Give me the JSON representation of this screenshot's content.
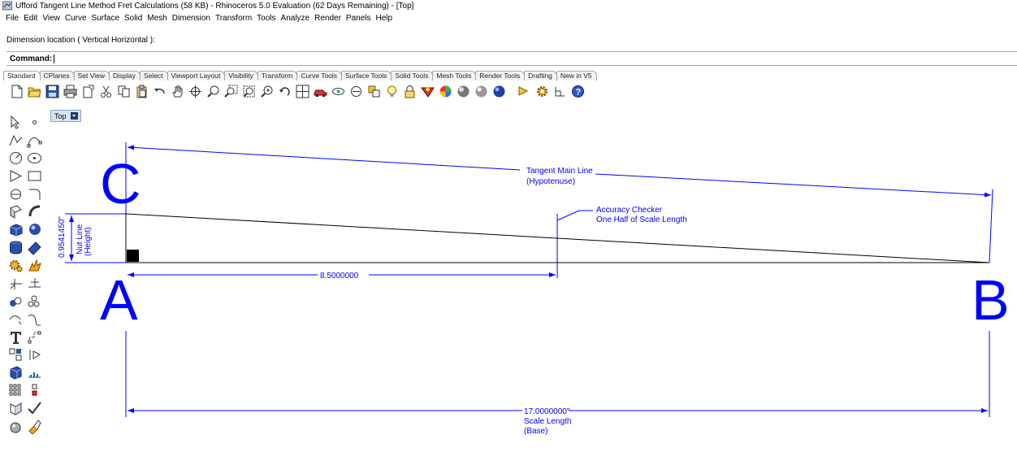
{
  "window": {
    "title": "Ufford Tangent Line Method Fret Calculations (58 KB) - Rhinoceros 5.0 Evaluation (62 Days Remaining) - [Top]"
  },
  "menu": [
    "File",
    "Edit",
    "View",
    "Curve",
    "Surface",
    "Solid",
    "Mesh",
    "Dimension",
    "Transform",
    "Tools",
    "Analyze",
    "Render",
    "Panels",
    "Help"
  ],
  "command": {
    "prompt": "Dimension location ( Vertical  Horizontal ):",
    "label": "Command:",
    "value": ""
  },
  "tabs": [
    "Standard",
    "CPlanes",
    "Set View",
    "Display",
    "Select",
    "Viewport Layout",
    "Visibility",
    "Transform",
    "Curve Tools",
    "Surface Tools",
    "Solid Tools",
    "Mesh Tools",
    "Render Tools",
    "Drafting",
    "New in V5"
  ],
  "active_tab": "Standard",
  "toolbar_icons": [
    "new-file-icon",
    "open-folder-icon",
    "save-icon",
    "print-icon",
    "import-icon",
    "cut-icon",
    "copy-icon",
    "paste-icon",
    "undo-icon",
    "pan-hand-icon",
    "rotate-view-icon",
    "zoom-icon",
    "zoom-window-icon",
    "zoom-extents-icon",
    "zoom-selected-icon",
    "undo-view-icon",
    "four-viewports-icon",
    "car-icon",
    "properties-eye-icon",
    "show-icon",
    "layer-icon",
    "lightbulb-icon",
    "lock-icon",
    "render-icon",
    "color-wheel-icon",
    "sphere-icon",
    "material-icon",
    "render-sphere-icon",
    "options-icon",
    "gear-icon",
    "grid-snap-icon",
    "help-icon"
  ],
  "sidebar_icons": [
    [
      "select-arrow-icon",
      "point-icon"
    ],
    [
      "polyline-icon",
      "curve-points-icon"
    ],
    [
      "circle-icon",
      "ellipse-icon"
    ],
    [
      "polygon-icon",
      "rectangle-icon"
    ],
    [
      "arc-icon",
      "fillet-icon"
    ],
    [
      "surface-icon",
      "surface-revolve-icon"
    ],
    [
      "box-icon",
      "sphere-solid-icon"
    ],
    [
      "extrude-icon",
      "solid-edit-icon"
    ],
    [
      "transform-gear-icon",
      "explode-icon"
    ],
    [
      "trim-icon",
      "join-icon"
    ],
    [
      "group-icon",
      "points-cloud-icon"
    ],
    [
      "curve-offset-icon",
      "curve-blend-icon"
    ],
    [
      "text-icon",
      "dimension-icon"
    ],
    [
      "block-icon",
      "history-icon"
    ],
    [
      "mesh-icon",
      "analyze-icon"
    ],
    [
      "array-icon",
      "distribute-icon"
    ],
    [
      "project-icon",
      "check-icon"
    ],
    [
      "render-mesh-icon",
      "paint-icon"
    ]
  ],
  "viewport": {
    "name": "Top",
    "labels": {
      "C": "C",
      "A": "A",
      "B": "B"
    },
    "dimensions": {
      "hypotenuse_line1": "Tangent Main Line",
      "hypotenuse_line2": "(Hypotenuse)",
      "checker_line1": "Accuracy Checker",
      "checker_line2": "One Half of Scale Length",
      "height_value": "0.9541450\"",
      "height_line1": "Nut Line",
      "height_line2": "(Height)",
      "half_value": "8.5000000",
      "base_value": "17.0000000\"",
      "base_line1": "Scale Length",
      "base_line2": "(Base)"
    }
  },
  "colors": {
    "dimension": "#0000ff",
    "geometry": "#000000",
    "viewport_tab": "#d6e3f5"
  }
}
